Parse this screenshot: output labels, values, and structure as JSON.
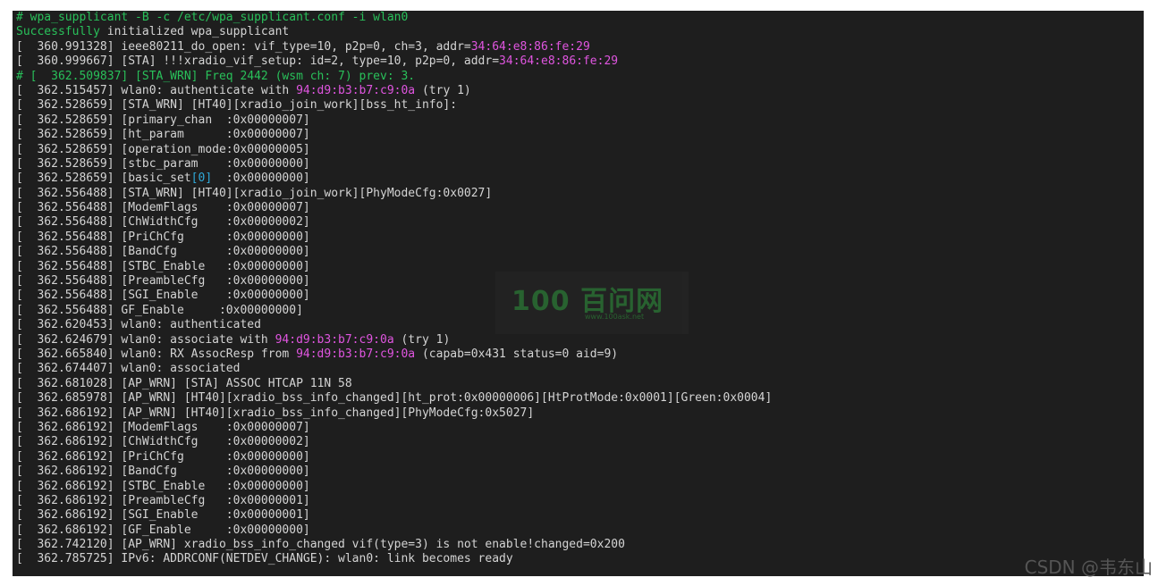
{
  "terminal": {
    "lines": [
      [
        [
          "g",
          "# wpa_supplicant -B -c /etc/wpa_supplicant.conf -i wlan0"
        ]
      ],
      [
        [
          "g",
          "Successfully"
        ],
        [
          "w",
          " initialized wpa_supplicant"
        ]
      ],
      [
        [
          "w",
          "[  360.991328] ieee80211_do_open: vif_type=10, p2p=0, ch=3, addr="
        ],
        [
          "m",
          "34:64:e8:86:fe:29"
        ]
      ],
      [
        [
          "w",
          "[  360.999667] [STA] !!!xradio_vif_setup: id=2, type=10, p2p=0, addr="
        ],
        [
          "m",
          "34:64:e8:86:fe:29"
        ]
      ],
      [
        [
          "g",
          "# [  362.509837] [STA_WRN] Freq 2442 (wsm ch: 7) prev: 3."
        ]
      ],
      [
        [
          "w",
          "[  362.515457] wlan0: authenticate with "
        ],
        [
          "m",
          "94:d9:b3:b7:c9:0a"
        ],
        [
          "w",
          " (try 1)"
        ]
      ],
      [
        [
          "w",
          "[  362.528659] [STA_WRN] [HT40][xradio_join_work][bss_ht_info]:"
        ]
      ],
      [
        [
          "w",
          "[  362.528659] [primary_chan  :0x00000007]"
        ]
      ],
      [
        [
          "w",
          "[  362.528659] [ht_param      :0x00000007]"
        ]
      ],
      [
        [
          "w",
          "[  362.528659] [operation_mode:0x00000005]"
        ]
      ],
      [
        [
          "w",
          "[  362.528659] [stbc_param    :0x00000000]"
        ]
      ],
      [
        [
          "w",
          "[  362.528659] [basic_set"
        ],
        [
          "c",
          "[0]"
        ],
        [
          "w",
          "  :0x00000000]"
        ]
      ],
      [
        [
          "w",
          "[  362.556488] [STA_WRN] [HT40][xradio_join_work][PhyModeCfg:0x0027]"
        ]
      ],
      [
        [
          "w",
          "[  362.556488] [ModemFlags    :0x00000007]"
        ]
      ],
      [
        [
          "w",
          "[  362.556488] [ChWidthCfg    :0x00000002]"
        ]
      ],
      [
        [
          "w",
          "[  362.556488] [PriChCfg      :0x00000000]"
        ]
      ],
      [
        [
          "w",
          "[  362.556488] [BandCfg       :0x00000000]"
        ]
      ],
      [
        [
          "w",
          "[  362.556488] [STBC_Enable   :0x00000000]"
        ]
      ],
      [
        [
          "w",
          "[  362.556488] [PreambleCfg   :0x00000000]"
        ]
      ],
      [
        [
          "w",
          "[  362.556488] [SGI_Enable    :0x00000000]"
        ]
      ],
      [
        [
          "w",
          "[  362.556488] GF_Enable     :0x00000000]"
        ]
      ],
      [
        [
          "w",
          "[  362.620453] wlan0: authenticated"
        ]
      ],
      [
        [
          "w",
          "[  362.624679] wlan0: associate with "
        ],
        [
          "m",
          "94:d9:b3:b7:c9:0a"
        ],
        [
          "w",
          " (try 1)"
        ]
      ],
      [
        [
          "w",
          "[  362.665840] wlan0: RX AssocResp from "
        ],
        [
          "m",
          "94:d9:b3:b7:c9:0a"
        ],
        [
          "w",
          " (capab=0x431 status=0 aid=9)"
        ]
      ],
      [
        [
          "w",
          "[  362.674407] wlan0: associated"
        ]
      ],
      [
        [
          "w",
          "[  362.681028] [AP_WRN] [STA] ASSOC HTCAP 11N 58"
        ]
      ],
      [
        [
          "w",
          "[  362.685978] [AP_WRN] [HT40][xradio_bss_info_changed][ht_prot:0x00000006][HtProtMode:0x0001][Green:0x0004]"
        ]
      ],
      [
        [
          "w",
          "[  362.686192] [AP_WRN] [HT40][xradio_bss_info_changed][PhyModeCfg:0x5027]"
        ]
      ],
      [
        [
          "w",
          "[  362.686192] [ModemFlags    :0x00000007]"
        ]
      ],
      [
        [
          "w",
          "[  362.686192] [ChWidthCfg    :0x00000002]"
        ]
      ],
      [
        [
          "w",
          "[  362.686192] [PriChCfg      :0x00000000]"
        ]
      ],
      [
        [
          "w",
          "[  362.686192] [BandCfg       :0x00000000]"
        ]
      ],
      [
        [
          "w",
          "[  362.686192] [STBC_Enable   :0x00000000]"
        ]
      ],
      [
        [
          "w",
          "[  362.686192] [PreambleCfg   :0x00000001]"
        ]
      ],
      [
        [
          "w",
          "[  362.686192] [SGI_Enable    :0x00000001]"
        ]
      ],
      [
        [
          "w",
          "[  362.686192] [GF_Enable     :0x00000000]"
        ]
      ],
      [
        [
          "w",
          "[  362.742120] [AP_WRN] xradio_bss_info_changed vif(type=3) is not enable!changed=0x200"
        ]
      ],
      [
        [
          "w",
          "[  362.785725] IPv6: ADDRCONF(NETDEV_CHANGE): wlan0: link becomes ready"
        ]
      ]
    ]
  },
  "watermark": {
    "logo": "100 百问网",
    "url": "www.100ask.net"
  },
  "footer": {
    "credit": "CSDN @韦东山"
  },
  "colors": {
    "background": "#1e1e1e",
    "text": "#d4d4d4",
    "prompt_green": "#29c05a",
    "mac_magenta": "#e055e0",
    "index_cyan": "#2fa8d8"
  }
}
